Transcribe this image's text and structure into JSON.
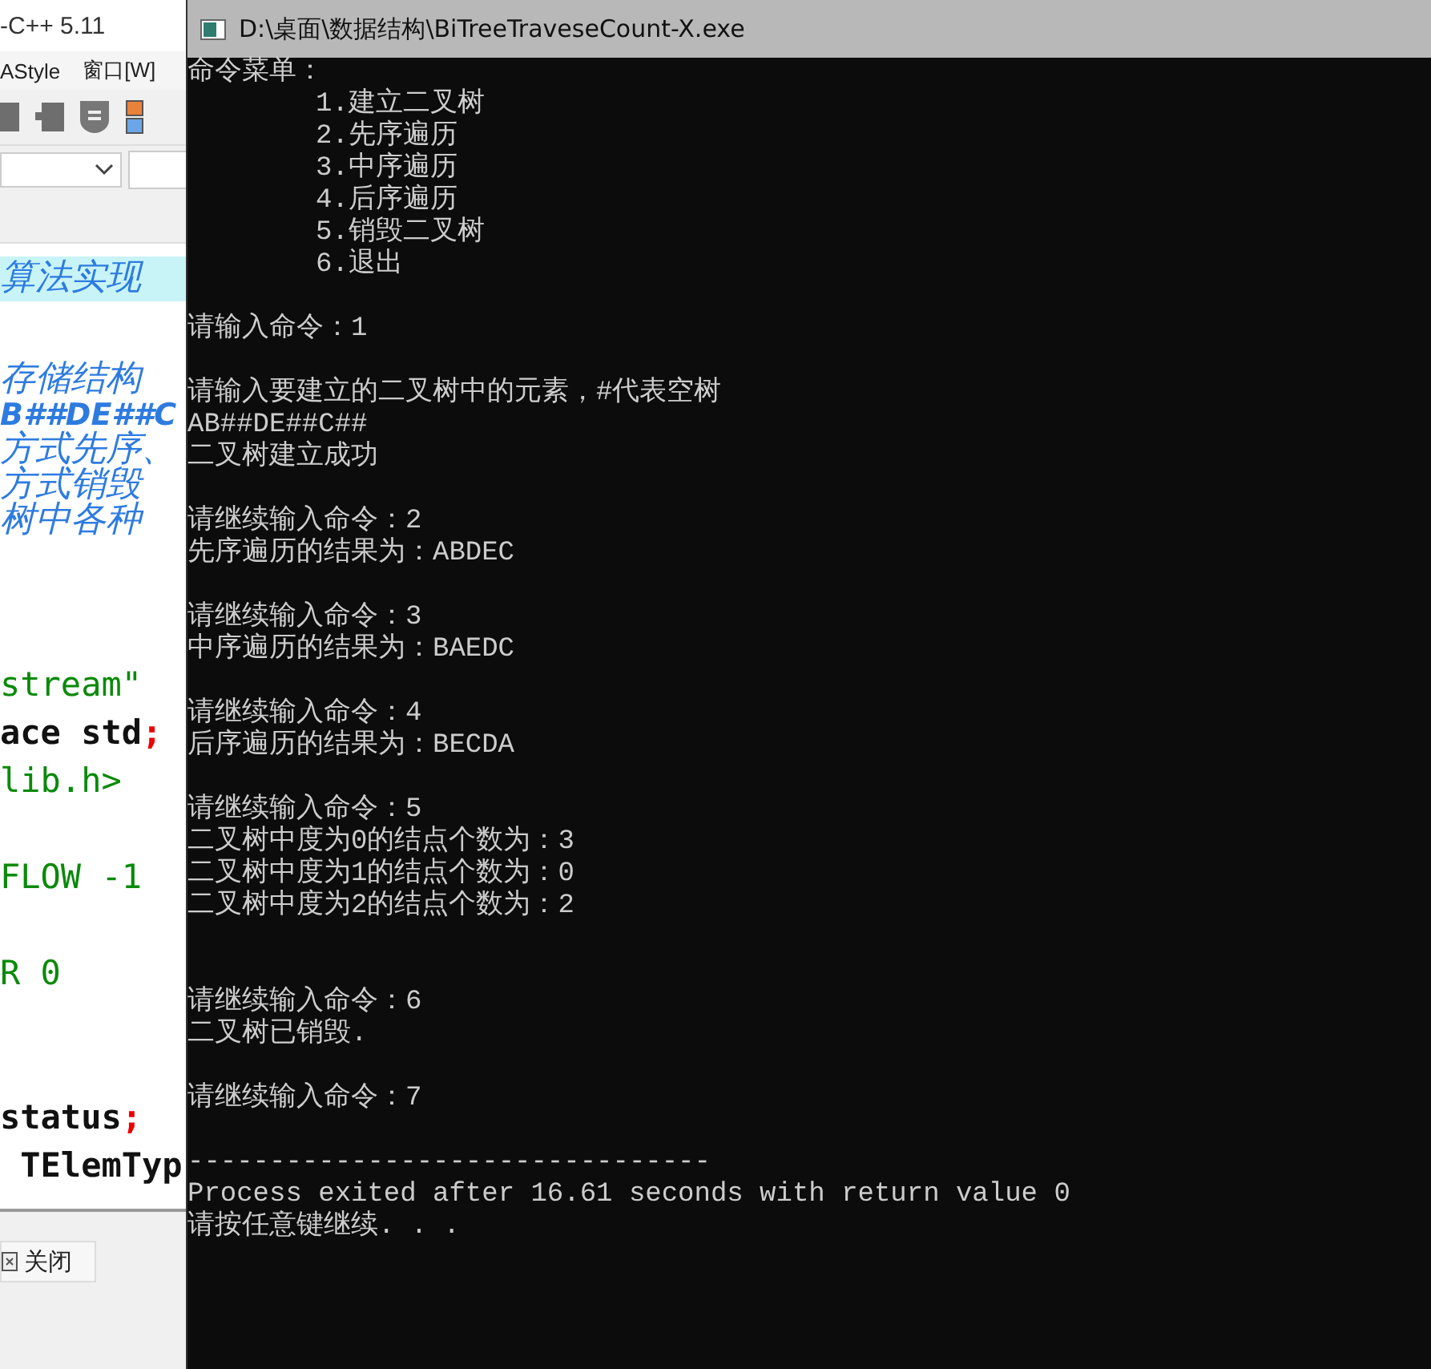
{
  "ide": {
    "title": "-C++ 5.11",
    "menu": [
      "AStyle",
      "窗口[W]"
    ],
    "comments": [
      {
        "highlighted": true,
        "bold": false,
        "text": "算法实现"
      },
      {
        "highlighted": false,
        "bold": false,
        "text": "存储结构"
      },
      {
        "highlighted": false,
        "bold": true,
        "text": "B##DE##C"
      },
      {
        "highlighted": false,
        "bold": false,
        "text": "方式先序、"
      },
      {
        "highlighted": false,
        "bold": false,
        "text": "方式销毁"
      },
      {
        "highlighted": false,
        "bold": false,
        "text": "树中各种"
      }
    ],
    "code_lines": [
      {
        "kind": "code",
        "tokens": [
          {
            "kind": "string",
            "text": "stream\""
          }
        ]
      },
      {
        "kind": "code",
        "tokens": [
          {
            "kind": "plain",
            "text": "ace std"
          },
          {
            "kind": "punct",
            "text": ";"
          }
        ]
      },
      {
        "kind": "code",
        "tokens": [
          {
            "kind": "string",
            "text": "lib.h>"
          }
        ]
      },
      {
        "kind": "blank"
      },
      {
        "kind": "code",
        "tokens": [
          {
            "kind": "string",
            "text": "FLOW -1"
          }
        ]
      },
      {
        "kind": "blank"
      },
      {
        "kind": "code",
        "tokens": [
          {
            "kind": "string",
            "text": "R 0"
          }
        ]
      },
      {
        "kind": "blank"
      },
      {
        "kind": "blank"
      },
      {
        "kind": "code",
        "tokens": [
          {
            "kind": "plain",
            "text": "status"
          },
          {
            "kind": "punct",
            "text": ";"
          }
        ]
      },
      {
        "kind": "code",
        "tokens": [
          {
            "kind": "plain",
            "text": " TElemTyp"
          }
        ]
      }
    ],
    "bottom_tab": "关闭"
  },
  "console": {
    "title": "D:\\桌面\\数据结构\\BiTreeTraveseCount-X.exe",
    "lines": [
      {
        "kind": "text",
        "text": "命令菜单："
      },
      {
        "kind": "menu_item",
        "text": "1.建立二叉树"
      },
      {
        "kind": "menu_item",
        "text": "2.先序遍历"
      },
      {
        "kind": "menu_item",
        "text": "3.中序遍历"
      },
      {
        "kind": "menu_item",
        "text": "4.后序遍历"
      },
      {
        "kind": "menu_item",
        "text": "5.销毁二叉树"
      },
      {
        "kind": "menu_item",
        "text": "6.退出"
      },
      {
        "kind": "blank"
      },
      {
        "kind": "text",
        "text": "请输入命令：1"
      },
      {
        "kind": "blank"
      },
      {
        "kind": "text",
        "text": "请输入要建立的二叉树中的元素，#代表空树"
      },
      {
        "kind": "text",
        "text": "AB##DE##C##"
      },
      {
        "kind": "text",
        "text": "二叉树建立成功"
      },
      {
        "kind": "blank"
      },
      {
        "kind": "text",
        "text": "请继续输入命令：2"
      },
      {
        "kind": "text",
        "text": "先序遍历的结果为：ABDEC"
      },
      {
        "kind": "blank"
      },
      {
        "kind": "text",
        "text": "请继续输入命令：3"
      },
      {
        "kind": "text",
        "text": "中序遍历的结果为：BAEDC"
      },
      {
        "kind": "blank"
      },
      {
        "kind": "text",
        "text": "请继续输入命令：4"
      },
      {
        "kind": "text",
        "text": "后序遍历的结果为：BECDA"
      },
      {
        "kind": "blank"
      },
      {
        "kind": "text",
        "text": "请继续输入命令：5"
      },
      {
        "kind": "text",
        "text": "二叉树中度为0的结点个数为：3"
      },
      {
        "kind": "text",
        "text": "二叉树中度为1的结点个数为：0"
      },
      {
        "kind": "text",
        "text": "二叉树中度为2的结点个数为：2"
      },
      {
        "kind": "blank"
      },
      {
        "kind": "blank"
      },
      {
        "kind": "text",
        "text": "请继续输入命令：6"
      },
      {
        "kind": "text",
        "text": "二叉树已销毁."
      },
      {
        "kind": "blank"
      },
      {
        "kind": "text",
        "text": "请继续输入命令：7"
      },
      {
        "kind": "blank"
      },
      {
        "kind": "text",
        "text": "--------------------------------"
      },
      {
        "kind": "text",
        "text": "Process exited after 16.61 seconds with return value 0"
      },
      {
        "kind": "text",
        "text": "请按任意键继续. . ."
      }
    ]
  }
}
